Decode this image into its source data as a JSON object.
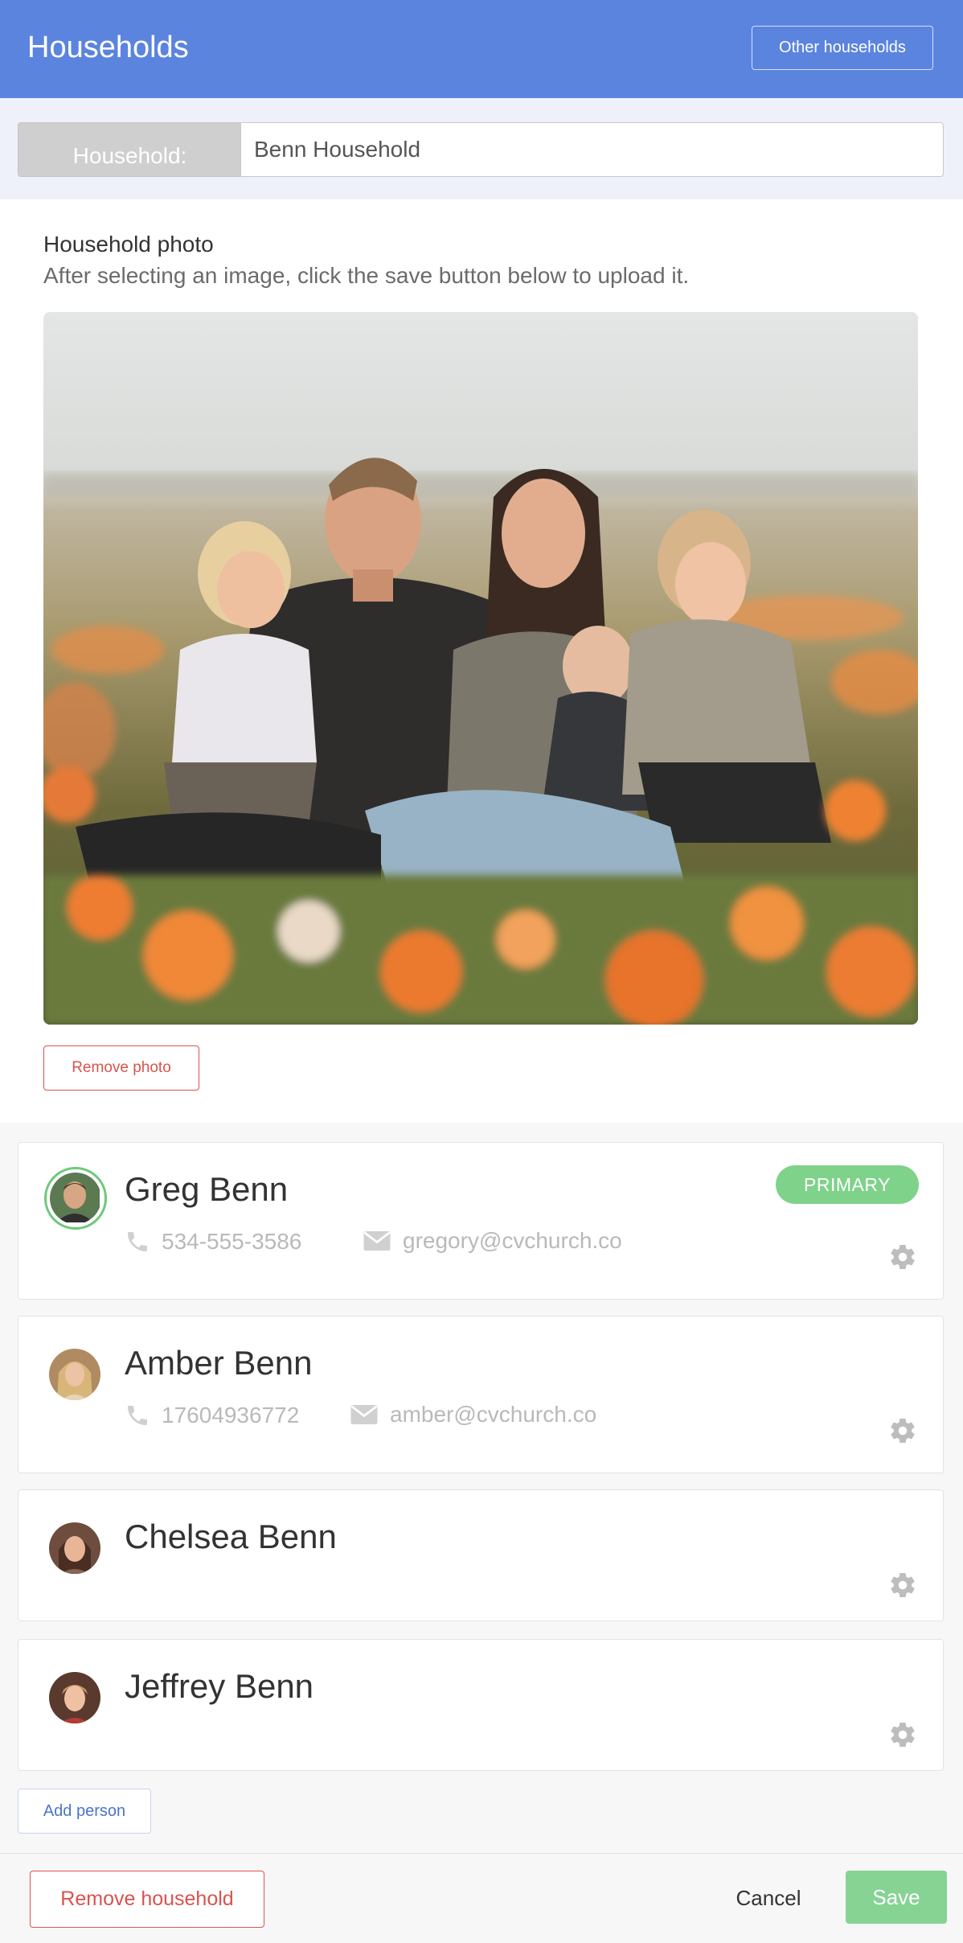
{
  "header": {
    "title": "Households",
    "other_households_label": "Other households",
    "color": "#5b84df"
  },
  "household": {
    "label": "Household:",
    "name": "Benn Household"
  },
  "photo": {
    "title": "Household photo",
    "help": "After selecting an image, click the save button below to upload it.",
    "remove_label": "Remove photo"
  },
  "members": [
    {
      "name": "Greg Benn",
      "phone": "534-555-3586",
      "email": "gregory@cvchurch.co",
      "badge": "PRIMARY",
      "is_primary": true
    },
    {
      "name": "Amber Benn",
      "phone": "17604936772",
      "email": "amber@cvchurch.co"
    },
    {
      "name": "Chelsea Benn"
    },
    {
      "name": "Jeffrey Benn"
    }
  ],
  "add_person_label": "Add person",
  "footer": {
    "remove_household_label": "Remove household",
    "cancel_label": "Cancel",
    "save_label": "Save"
  },
  "colors": {
    "primary_badge": "#7fd28a",
    "danger": "#d9534f",
    "save": "#86d394"
  },
  "icons": [
    "phone-icon",
    "envelope-icon",
    "gear-icon"
  ]
}
